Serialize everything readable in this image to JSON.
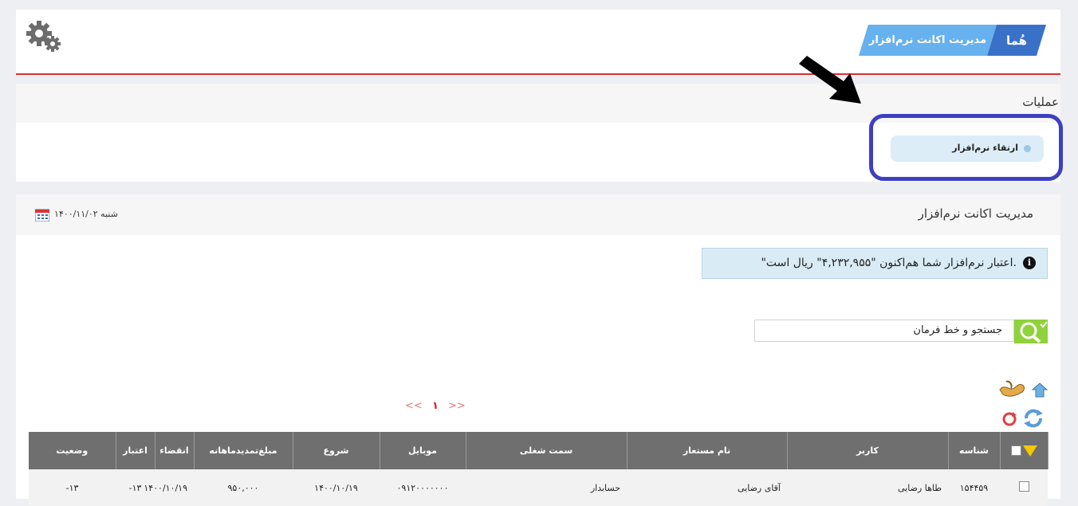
{
  "header": {
    "brand": "هُما",
    "app_title": "مدیریت اکانت نرم‌افزار"
  },
  "operations": {
    "title": "عملیات",
    "upgrade_button": "ارتقاء نرم‌افزار"
  },
  "main": {
    "title": "مدیریت اکانت نرم‌افزار",
    "date": "شنبه ۱۴۰۰/۱۱/۰۲",
    "credit_message": "\"اعتبار نرم‌افزار شما هم‌اکنون \"۴,۲۳۲,۹۵۵\" ریال است.",
    "search": {
      "value": "جستجو و خط فرمان"
    },
    "pager": {
      "prev": "<<",
      "current": "۱",
      "next": ">>"
    }
  },
  "table": {
    "columns": [
      "شناسه",
      "کاربر",
      "نام مستعار",
      "سمت شغلی",
      "موبایل",
      "شروع",
      "مبلغ‌تمدیدماهانه",
      "انقضاء",
      "اعتبار",
      "وضعیت"
    ],
    "rows": [
      [
        "۱۵۴۴۵۹",
        "طاها رضایی",
        "آقای رضایی",
        "حسابدار",
        "۰۹۱۲۰۰۰۰۰۰۰",
        "۱۴۰۰/۱۰/۱۹",
        "۹۵۰,۰۰۰",
        "۱۴۰۰/۱۰/۱۹",
        "۱۳-",
        "۱۳-"
      ]
    ]
  },
  "colors": {
    "accent_red": "#d93030",
    "brand_blue": "#3a71c8",
    "title_blue": "#66b1ee",
    "highlight_border": "#3d3fc3",
    "search_green": "#8fd23a"
  }
}
